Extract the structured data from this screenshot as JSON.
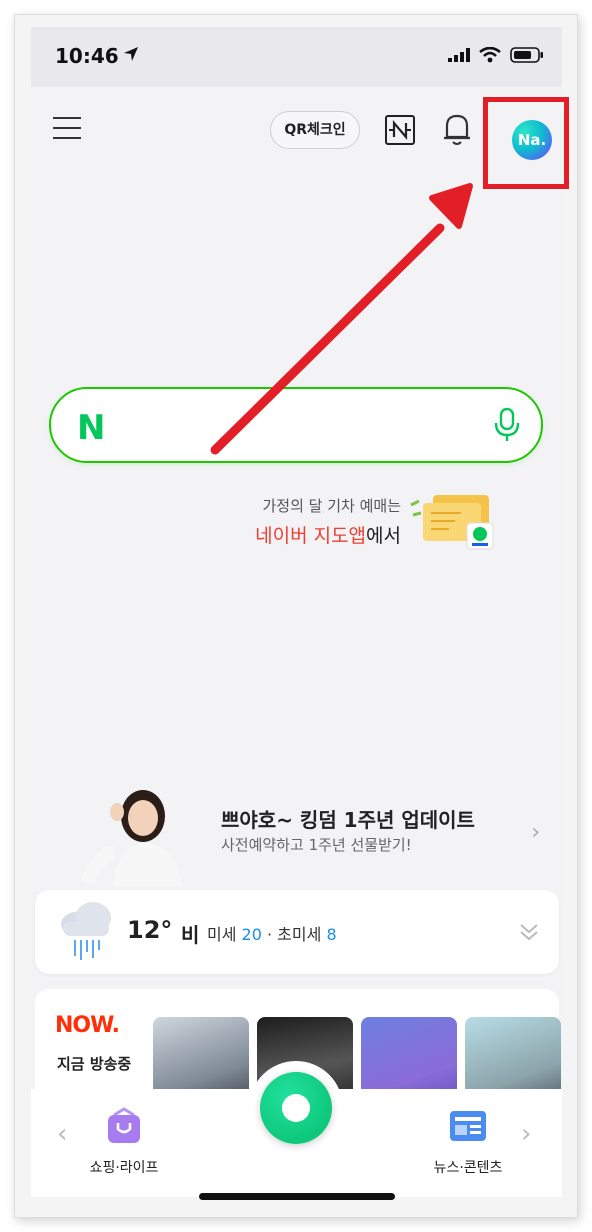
{
  "status_bar": {
    "time": "10:46"
  },
  "header": {
    "qr_label": "QR체크인",
    "avatar_text": "Na."
  },
  "search": {
    "logo_text": "N"
  },
  "promo": {
    "line1": "가정의 달 기차 예매는",
    "line2_highlight": "네이버 지도앱",
    "line2_rest": "에서"
  },
  "banner": {
    "title": "쁘야호~ 킹덤 1주년 업데이트",
    "subtitle": "사전예약하고 1주년 선물받기!"
  },
  "weather": {
    "temp": "12°",
    "condition": "비",
    "fine_dust_label": "미세",
    "fine_dust_value": "20",
    "separator": " · ",
    "ultra_fine_dust_label": "초미세",
    "ultra_fine_dust_value": "8"
  },
  "now": {
    "logo": "NOW.",
    "label": "지금 방송중"
  },
  "bottom_nav": {
    "left_label": "쇼핑·라이프",
    "right_label": "뉴스·콘텐츠"
  },
  "colors": {
    "naver_green": "#03c75a",
    "highlight_red": "#e21f26",
    "promo_red": "#ee4035",
    "dust_blue": "#1a8cf0"
  }
}
